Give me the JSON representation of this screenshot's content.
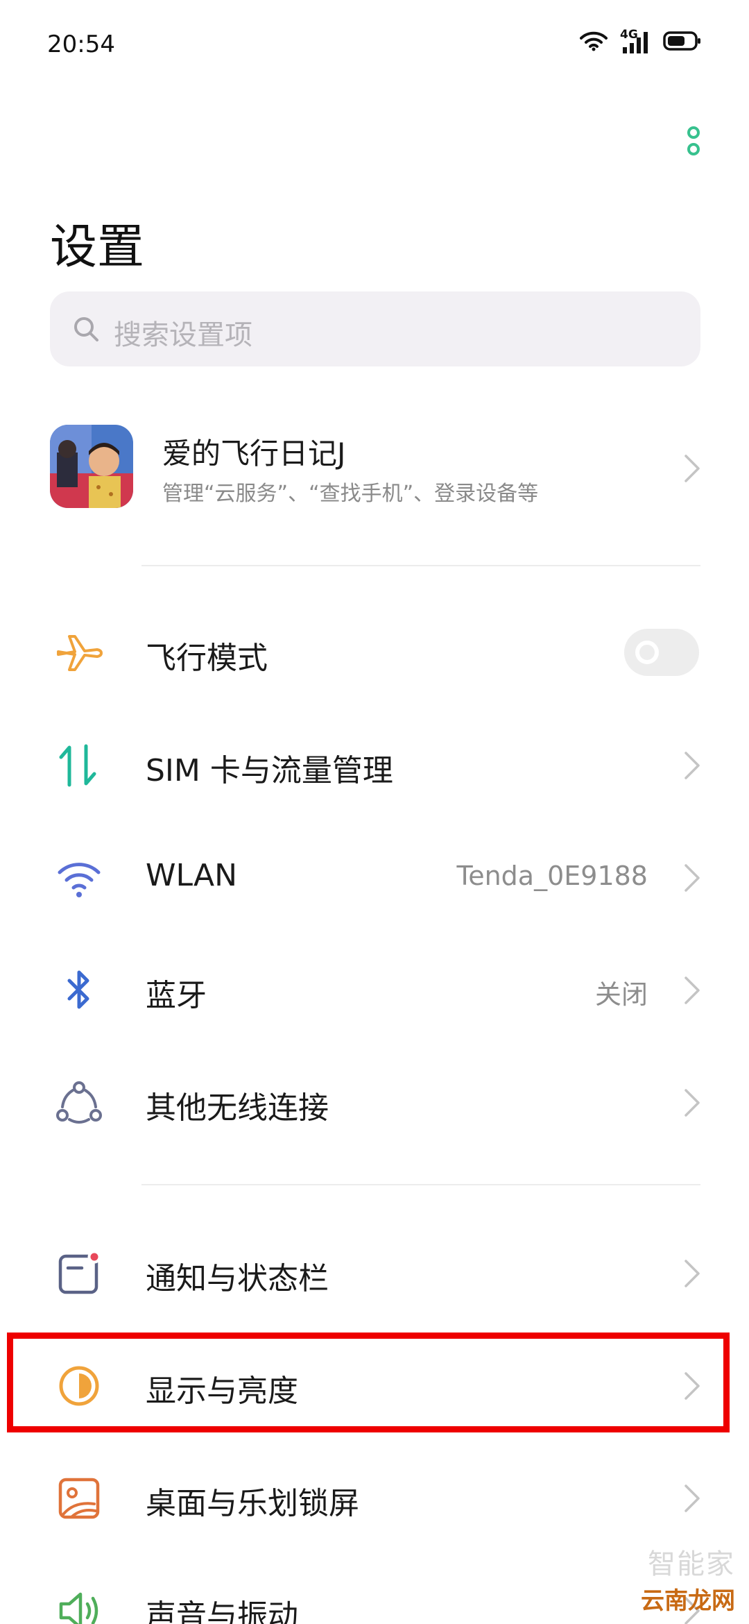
{
  "status_bar": {
    "time": "20:54",
    "network": "4G",
    "icons": [
      "wifi-icon",
      "cellular-signal-icon",
      "battery-icon"
    ]
  },
  "header": {
    "title": "设置",
    "more_icon": "more-vertical-icon"
  },
  "search": {
    "placeholder": "搜索设置项"
  },
  "account": {
    "name": "爱的飞行日记J",
    "subtitle": "管理“云服务”、“查找手机”、登录设备等"
  },
  "settings": [
    {
      "label": "飞行模式",
      "icon": "airplane-icon",
      "control": "toggle",
      "on": false
    },
    {
      "label": "SIM 卡与流量管理",
      "icon": "sim-data-icon",
      "control": "chevron"
    },
    {
      "label": "WLAN",
      "icon": "wifi-icon",
      "value": "Tenda_0E9188",
      "control": "chevron"
    },
    {
      "label": "蓝牙",
      "icon": "bluetooth-icon",
      "value": "关闭",
      "control": "chevron"
    },
    {
      "label": "其他无线连接",
      "icon": "connections-icon",
      "control": "chevron"
    },
    {
      "label": "通知与状态栏",
      "icon": "notification-icon",
      "control": "chevron"
    },
    {
      "label": "显示与亮度",
      "icon": "display-brightness-icon",
      "control": "chevron",
      "highlighted": true
    },
    {
      "label": "桌面与乐划锁屏",
      "icon": "wallpaper-icon",
      "control": "chevron"
    },
    {
      "label": "声音与振动",
      "icon": "sound-icon",
      "control": "chevron"
    }
  ],
  "colors": {
    "accent_green": "#37c18e",
    "airplane_orange": "#f0a33b",
    "sim_teal": "#1fb89a",
    "wifi_blue": "#5a6fd6",
    "bluetooth_blue": "#3b6ad0",
    "highlight_red": "#ee0000"
  },
  "watermark": {
    "top": "智能家",
    "bottom": "云南龙网"
  }
}
